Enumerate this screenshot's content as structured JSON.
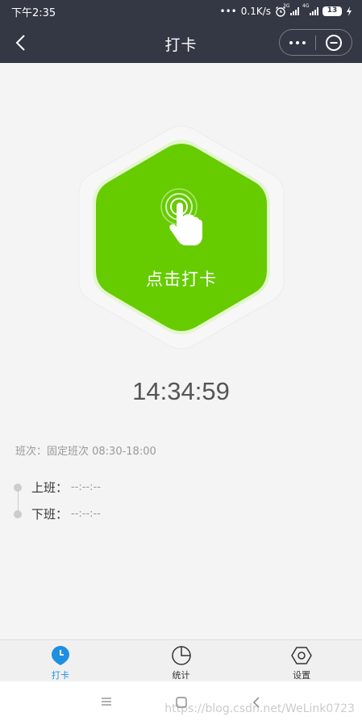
{
  "status_bar": {
    "time": "下午2:35",
    "network_speed": "0.1K/s",
    "alarm_icon": "alarm-clock-icon",
    "sim1": "3G",
    "sim2": "4G",
    "battery": "13",
    "charging_icon": "lightning-icon"
  },
  "nav": {
    "title": "打卡",
    "back_icon": "chevron-left-icon",
    "more_icon": "ellipsis-icon",
    "close_icon": "circle-minus-icon"
  },
  "punch": {
    "label": "点击打卡",
    "icon": "finger-tap-icon",
    "color": "#66cc00"
  },
  "clock": {
    "time": "14:34:59"
  },
  "shift": {
    "text": "班次：固定班次 08:30-18:00"
  },
  "records": [
    {
      "label": "上班：",
      "value": "--:--:--"
    },
    {
      "label": "下班：",
      "value": "--:--:--"
    }
  ],
  "tabs": [
    {
      "label": "打卡",
      "icon": "location-clock-icon",
      "active": true,
      "color": "#1e8fe1"
    },
    {
      "label": "统计",
      "icon": "pie-chart-icon",
      "active": false
    },
    {
      "label": "设置",
      "icon": "hexagon-settings-icon",
      "active": false
    }
  ],
  "system_nav": {
    "menu_icon": "menu-icon",
    "home_icon": "square-home-icon",
    "back_icon": "triangle-back-icon",
    "watermark": "https://blog.csdn.net/WeLink0723"
  }
}
